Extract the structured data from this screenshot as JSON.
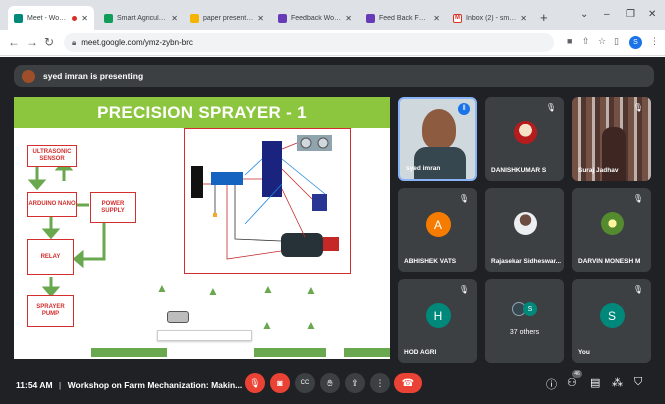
{
  "tabs": [
    {
      "title": "Meet - Worksho",
      "active": true,
      "fav_color": "#00897b",
      "recording": true
    },
    {
      "title": "Smart Agriculture Mo",
      "fav_color": "#0f9d58"
    },
    {
      "title": "paper presented - Go",
      "fav_color": "#f4b400"
    },
    {
      "title": "Feedback Workshop",
      "fav_color": "#673ab7"
    },
    {
      "title": "Feed Back Form for",
      "fav_color": "#673ab7"
    },
    {
      "title": "Inbox (2) - smartagric",
      "fav_color": "#d93025"
    }
  ],
  "window": {
    "minimize": "⌄",
    "min": "–",
    "restore": "❐",
    "close": "✕"
  },
  "address": {
    "url": "meet.google.com/ymz-zybn-brc",
    "profile_initial": "S"
  },
  "presenting_text": "syed imran is presenting",
  "slide": {
    "title": "PRECISION SPRAYER - 1",
    "blocks": {
      "ultrasonic": "ULTRASONIC SENSOR",
      "arduino": "ARDUINO NANO",
      "power": "POWER SUPPLY",
      "relay": "RELAY",
      "pump": "SPRAYER PUMP"
    }
  },
  "participants": [
    {
      "name": "syed imran",
      "speaking": true
    },
    {
      "name": "DANISHKUMAR S",
      "muted": true
    },
    {
      "name": "Suraj Jadhav",
      "muted": true
    },
    {
      "name": "ABHISHEK VATS",
      "initial": "A",
      "color": "#f57c00",
      "muted": true
    },
    {
      "name": "Rajasekar Sidheswar...",
      "muted": true
    },
    {
      "name": "DARVIN MONESH M",
      "muted": true
    },
    {
      "name": "HOD AGRI",
      "initial": "H",
      "color": "#00897b",
      "muted": true
    },
    {
      "name": "37 others",
      "initial": "S"
    },
    {
      "name": "You",
      "initial": "S",
      "color": "#00897b",
      "muted": true
    }
  ],
  "bottom": {
    "time": "11:54 AM",
    "separator": "|",
    "meeting_title": "Workshop on Farm Mechanization: Makin...",
    "participant_count": "46"
  }
}
